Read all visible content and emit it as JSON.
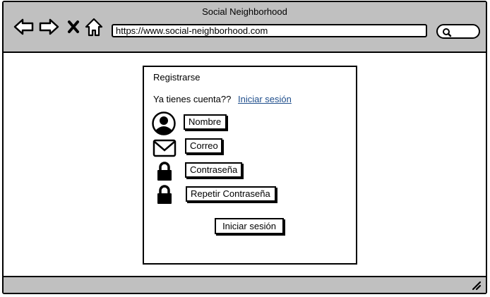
{
  "window": {
    "title": "Social Neighborhood"
  },
  "browser": {
    "url": "https://www.social-neighborhood.com",
    "nav_icons": [
      "back-arrow-icon",
      "forward-arrow-icon",
      "close-icon",
      "home-icon"
    ],
    "search_icon": "search-icon"
  },
  "form": {
    "title": "Registrarse",
    "prompt": "Ya tienes cuenta??",
    "login_link": "Iniciar sesión",
    "fields": [
      {
        "label": "Nombre",
        "icon": "user-icon"
      },
      {
        "label": "Correo",
        "icon": "mail-icon"
      },
      {
        "label": "Contraseña",
        "icon": "lock-icon"
      },
      {
        "label": "Repetir Contraseña",
        "icon": "lock-icon"
      }
    ],
    "submit_label": "Iniciar sesión"
  },
  "status": {
    "resize_icon": "resize-grip-icon"
  }
}
